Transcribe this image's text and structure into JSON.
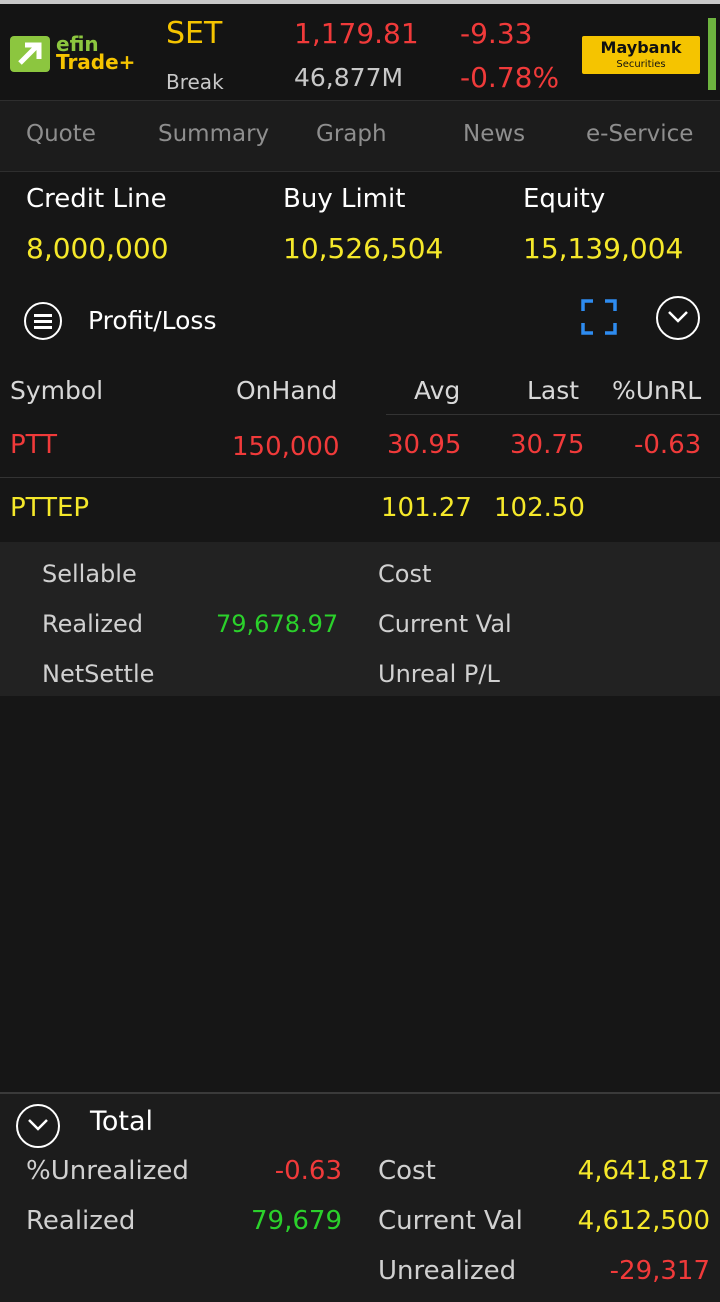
{
  "header": {
    "logo_efin": "efin",
    "logo_trade": "Trade+",
    "market": "SET",
    "break_label": "Break",
    "index": "1,179.81",
    "volume": "46,877M",
    "change": "-9.33",
    "change_pct": "-0.78%",
    "broker": "Maybank",
    "broker_sub": "Securities",
    "colors": {
      "up_green": "#8cc63f",
      "down_red": "#f03a3a",
      "accent_yellow": "#f5c400"
    }
  },
  "tabs": [
    {
      "label": "Quote"
    },
    {
      "label": "Summary"
    },
    {
      "label": "Graph"
    },
    {
      "label": "News"
    },
    {
      "label": "e-Service"
    }
  ],
  "account": {
    "credit_line_label": "Credit Line",
    "credit_line": "8,000,000",
    "buy_limit_label": "Buy Limit",
    "buy_limit": "10,526,504",
    "equity_label": "Equity",
    "equity": "15,139,004"
  },
  "section": {
    "title": "Profit/Loss",
    "menu_icon": "list-icon",
    "expand_icon": "fullscreen-icon",
    "collapse_icon": "chevron-down-icon"
  },
  "table": {
    "headers": [
      "Symbol",
      "OnHand",
      "Avg",
      "Last",
      "%UnRL"
    ],
    "rows": [
      {
        "symbol": "PTT",
        "onhand": "150,000",
        "avg": "30.95",
        "last": "30.75",
        "unrl": "-0.63"
      },
      {
        "symbol": "PTTEP",
        "onhand": "",
        "avg": "101.27",
        "last": "102.50",
        "unrl": ""
      }
    ]
  },
  "detail": {
    "sellable_label": "Sellable",
    "sellable": "",
    "realized_label": "Realized",
    "realized": "79,678.97",
    "netsettle_label": "NetSettle",
    "netsettle": "",
    "cost_label": "Cost",
    "cost": "",
    "current_val_label": "Current Val",
    "current_val": "",
    "unreal_label": "Unreal P/L",
    "unreal": ""
  },
  "total": {
    "title": "Total",
    "unrealized_label": "%Unrealized",
    "unrealized": "-0.63",
    "realized_label": "Realized",
    "realized": "79,679",
    "cost_label": "Cost",
    "cost": "4,641,817",
    "current_val_label": "Current Val",
    "current_val": "4,612,500",
    "unrealized_amt_label": "Unrealized",
    "unrealized_amt": "-29,317"
  }
}
